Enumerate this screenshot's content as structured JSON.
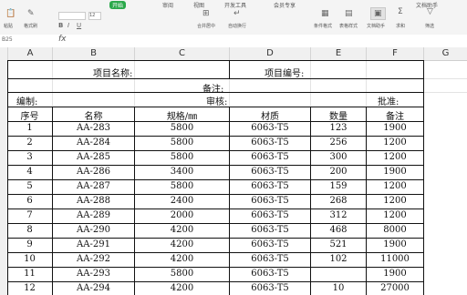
{
  "ribbon": {
    "tabs": [
      "审阅",
      "视图",
      "开发工具",
      "会员专享",
      "文档助手"
    ],
    "active_tab": "开始",
    "tools": [
      {
        "label": "粘贴",
        "icon": "paste-icon"
      },
      {
        "label": "格式刷",
        "icon": "format-painter-icon"
      },
      {
        "label": "合并居中",
        "icon": "merge-center-icon"
      },
      {
        "label": "自动换行",
        "icon": "wrap-text-icon"
      },
      {
        "label": "条件格式",
        "icon": "conditional-format-icon"
      },
      {
        "label": "表格样式",
        "icon": "table-style-icon"
      },
      {
        "label": "求和",
        "icon": "sum-icon"
      },
      {
        "label": "筛选",
        "icon": "filter-icon"
      },
      {
        "label": "文档助手",
        "icon": "doc-assistant-icon"
      }
    ],
    "font_size_value": "12"
  },
  "formula_bar": {
    "name_box": "B25",
    "fx_label": "fx",
    "formula_value": ""
  },
  "columns": [
    "A",
    "B",
    "C",
    "D",
    "E",
    "F",
    "G"
  ],
  "sheet": {
    "project_name_label": "项目名称:",
    "project_no_label": "项目编号:",
    "remarks_label": "备注:",
    "compiled_by_label": "编制:",
    "reviewed_by_label": "审核:",
    "approved_by_label": "批准:",
    "headers": [
      "序号",
      "名称",
      "规格/㎜",
      "材质",
      "数量",
      "备注"
    ],
    "rows": [
      [
        "1",
        "AA-283",
        "5800",
        "6063-T5",
        "123",
        "1900"
      ],
      [
        "2",
        "AA-284",
        "5800",
        "6063-T5",
        "256",
        "1200"
      ],
      [
        "3",
        "AA-285",
        "5800",
        "6063-T5",
        "300",
        "1200"
      ],
      [
        "4",
        "AA-286",
        "3400",
        "6063-T5",
        "200",
        "1900"
      ],
      [
        "5",
        "AA-287",
        "5800",
        "6063-T5",
        "159",
        "1200"
      ],
      [
        "6",
        "AA-288",
        "2400",
        "6063-T5",
        "268",
        "1200"
      ],
      [
        "7",
        "AA-289",
        "2000",
        "6063-T5",
        "312",
        "1200"
      ],
      [
        "8",
        "AA-290",
        "4200",
        "6063-T5",
        "468",
        "8000"
      ],
      [
        "9",
        "AA-291",
        "4200",
        "6063-T5",
        "521",
        "1900"
      ],
      [
        "10",
        "AA-292",
        "4200",
        "6063-T5",
        "102",
        "11000"
      ],
      [
        "11",
        "AA-293",
        "5800",
        "6063-T5",
        "",
        "1900"
      ],
      [
        "12",
        "AA-294",
        "4200",
        "6063-T5",
        "10",
        "27000"
      ]
    ]
  }
}
